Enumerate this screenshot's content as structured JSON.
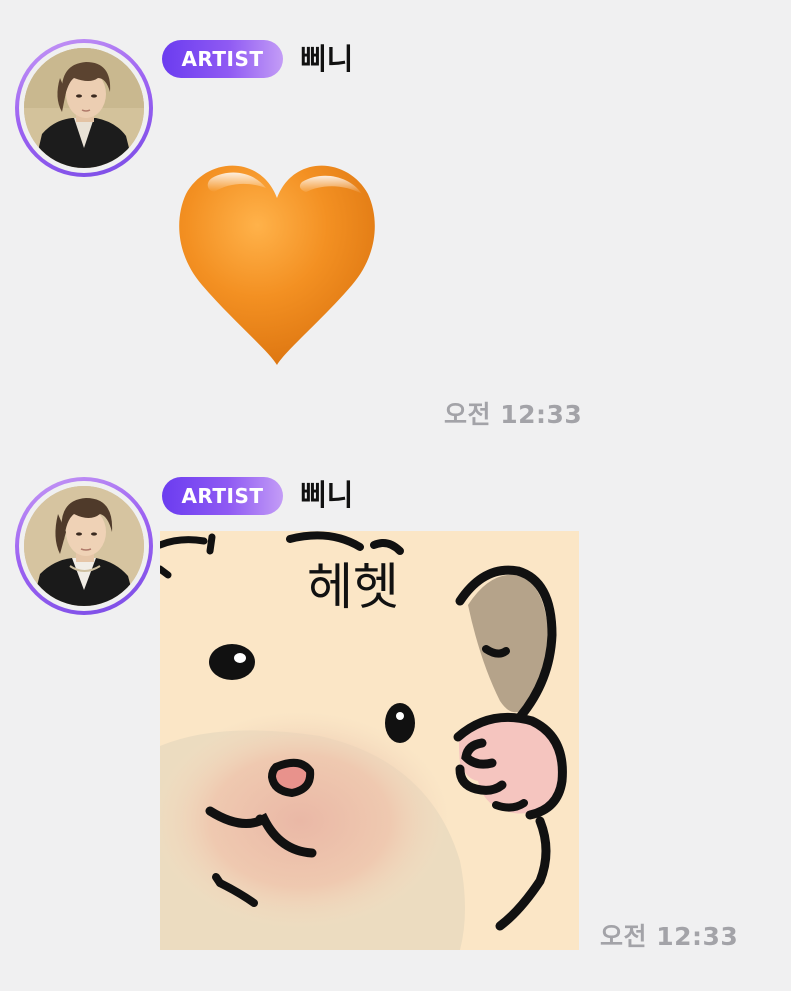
{
  "messages": [
    {
      "badge": "ARTIST",
      "sender": "삐니",
      "content_type": "emoji",
      "emoji": "orange-heart",
      "timestamp": "오전 12:33"
    },
    {
      "badge": "ARTIST",
      "sender": "삐니",
      "content_type": "sticker",
      "sticker_text": "헤헷",
      "timestamp": "오전 12:33"
    }
  ],
  "colors": {
    "background": "#f0f0f1",
    "badge_gradient_start": "#6b3cf0",
    "badge_gradient_end": "#c39cf6",
    "avatar_ring": "#9d63f2",
    "timestamp": "#a3a3a8",
    "heart": "#f08a1c",
    "sticker_bg": "#fbe6c6"
  }
}
